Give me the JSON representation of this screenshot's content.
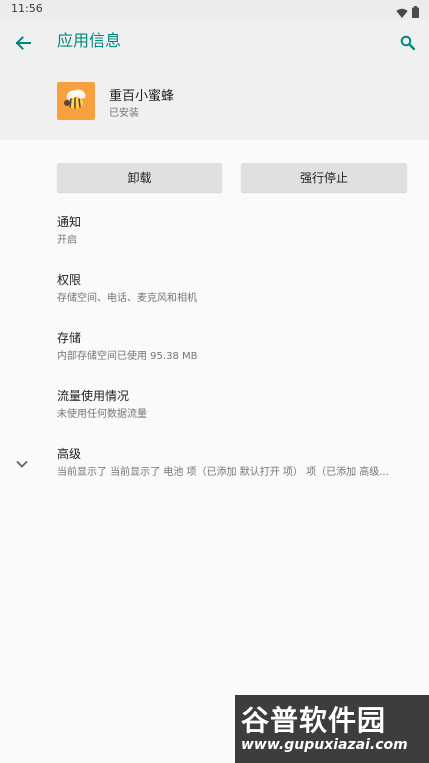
{
  "status_bar": {
    "time": "11:56",
    "icons": [
      "wifi-icon",
      "battery-icon"
    ]
  },
  "header": {
    "title": "应用信息",
    "back_icon": "arrow-left-icon",
    "search_icon": "search-icon"
  },
  "app": {
    "name": "重百小蜜蜂",
    "status": "已安装",
    "icon": "bee-icon",
    "icon_color": "#f7a13e"
  },
  "buttons": {
    "uninstall": "卸载",
    "force_stop": "强行停止"
  },
  "settings": [
    {
      "title": "通知",
      "summary": "开启"
    },
    {
      "title": "权限",
      "summary": "存储空间、电话、麦克风和相机"
    },
    {
      "title": "存储",
      "summary": "内部存储空间已使用 95.38 MB"
    },
    {
      "title": "流量使用情况",
      "summary": "未使用任何数据流量"
    },
    {
      "title": "高级",
      "summary": "当前显示了 当前显示了 电池 项（已添加 默认打开 项） 项（已添加 高级..."
    }
  ],
  "watermark": {
    "title": "谷普软件园",
    "url": "www.gupuxiazai.com"
  },
  "colors": {
    "accent": "#00897b",
    "header_bg": "#f0f0f0",
    "button_bg": "#e0e0e0"
  }
}
